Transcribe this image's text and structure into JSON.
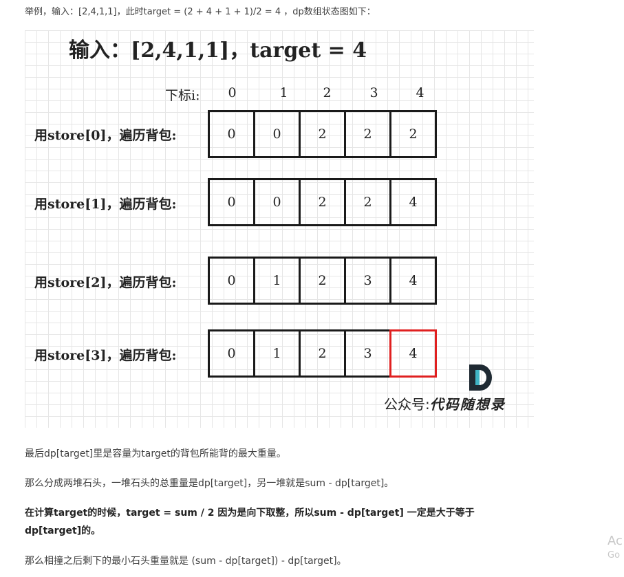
{
  "intro": "举例，输入：[2,4,1,1]，此时target = (2 + 4 + 1 + 1)/2 = 4 ，dp数组状态图如下：",
  "figure": {
    "title": "输入：[2,4,1,1]，target = 4",
    "index_label": "下标i:",
    "indices": [
      "0",
      "1",
      "2",
      "3",
      "4"
    ],
    "rows": [
      {
        "label": "用store[0]，遍历背包:",
        "values": [
          "0",
          "0",
          "2",
          "2",
          "2"
        ],
        "highlight": -1
      },
      {
        "label": "用store[1]，遍历背包:",
        "values": [
          "0",
          "0",
          "2",
          "2",
          "4"
        ],
        "highlight": -1
      },
      {
        "label": "用store[2]，遍历背包:",
        "values": [
          "0",
          "1",
          "2",
          "3",
          "4"
        ],
        "highlight": -1
      },
      {
        "label": "用store[3]，遍历背包:",
        "values": [
          "0",
          "1",
          "2",
          "3",
          "4"
        ],
        "highlight": 4
      }
    ],
    "highlight_color": "#e02020",
    "brand_prefix": "公众号:",
    "brand_name": "代码随想录",
    "logo_colors": {
      "primary": "#1f2a33",
      "accent": "#3fb3c4"
    }
  },
  "paragraphs": [
    {
      "text": "最后dp[target]里是容量为target的背包所能背的最大重量。",
      "bold": false
    },
    {
      "text": "那么分成两堆石头，一堆石头的总重量是dp[target]，另一堆就是sum - dp[target]。",
      "bold": false
    },
    {
      "text": "在计算target的时候，target = sum / 2 因为是向下取整，所以sum - dp[target] 一定是大于等于dp[target]的。",
      "bold": true
    },
    {
      "text": "那么相撞之后剩下的最小石头重量就是 (sum - dp[target]) - dp[target]。",
      "bold": false
    }
  ],
  "watermark": {
    "line1": "Ac",
    "line2": "Go"
  }
}
